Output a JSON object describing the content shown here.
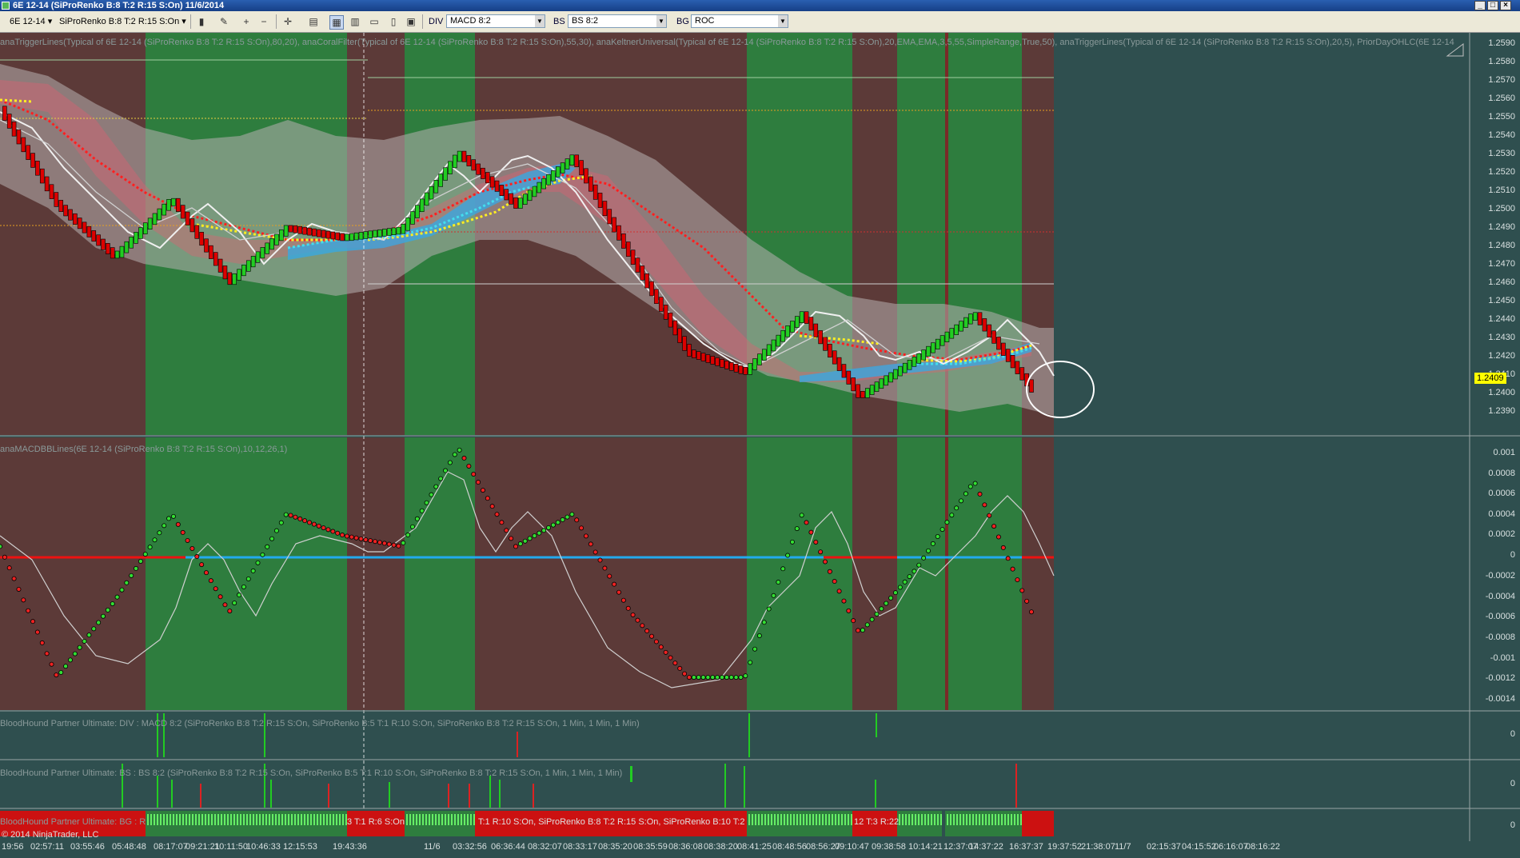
{
  "window": {
    "title": "6E 12-14 (SiProRenko B:8 T:2 R:15 S:On)  11/6/2014"
  },
  "toolbar": {
    "instrument": "6E 12-14",
    "bars": "SiProRenko B:8 T:2 R:15 S:On",
    "div_label": "DIV",
    "div_value": "MACD 8:2",
    "bs_label": "BS",
    "bs_value": "BS 8:2",
    "bg_label": "BG",
    "bg_value": "ROC"
  },
  "panels": {
    "price_indicators": "anaTriggerLines(Typical of 6E 12-14 (SiProRenko B:8 T:2 R:15 S:On),80,20), anaCoralFilter(Typical of 6E 12-14 (SiProRenko B:8 T:2 R:15 S:On),55,30), anaKeltnerUniversal(Typical of 6E 12-14 (SiProRenko B:8 T:2 R:15 S:On),20,EMA,EMA,3,5,55,SimpleRange,True,50), anaTriggerLines(Typical of 6E 12-14 (SiProRenko B:8 T:2 R:15 S:On),20,5), PriorDayOHLC(6E 12-14",
    "macd": "anaMACDBBLines(6E 12-14 (SiProRenko B:8 T:2 R:15 S:On),10,12,26,1)",
    "div": "BloodHound Partner Ultimate: DIV : MACD 8:2 (SiProRenko B:8 T:2 R:15 S:On, SiProRenko B:5 T:1 R:10 S:On, SiProRenko B:8 T:2 R:15 S:On, 1 Min, 1 Min, 1 Min)",
    "bs": "BloodHound Partner Ultimate: BS : BS 8:2 (SiProRenko B:8 T:2 R:15 S:On, SiProRenko B:5 T:1 R:10 S:On, SiProRenko B:8 T:2 R:15 S:On, 1 Min, 1 Min, 1 Min)",
    "bg": "BloodHound Partner Ultimate: BG : R",
    "bg_mid1": "3 T:1 R:6 S:On",
    "bg_mid2": "T:1 R:10 S:On, SiProRenko B:8 T:2 R:15 S:On, SiProRenko B:10 T:2",
    "bg_mid3": "12 T:3 R:22",
    "copyright": "© 2014 NinjaTrader, LLC"
  },
  "price_axis": [
    "1.2590",
    "1.2580",
    "1.2570",
    "1.2560",
    "1.2550",
    "1.2540",
    "1.2530",
    "1.2520",
    "1.2510",
    "1.2500",
    "1.2490",
    "1.2480",
    "1.2470",
    "1.2460",
    "1.2450",
    "1.2440",
    "1.2430",
    "1.2420",
    "1.2410",
    "1.2400",
    "1.2390"
  ],
  "current_price": "1.2409",
  "macd_axis": [
    "0.001",
    "0.0008",
    "0.0006",
    "0.0004",
    "0.0002",
    "0",
    "-0.0002",
    "-0.0004",
    "-0.0006",
    "-0.0008",
    "-0.001",
    "-0.0012",
    "-0.0014"
  ],
  "sub_axis": [
    "0",
    "0",
    "0"
  ],
  "time_axis": [
    "19:56",
    "02:57:11",
    "03:55:46",
    "05:48:48",
    "08:17:07",
    "09:21:21",
    "10:11:50",
    "10:46:33",
    "12:15:53",
    "19:43:36",
    "11/6",
    "03:32:56",
    "06:36:44",
    "08:32:07",
    "08:33:17",
    "08:35:20",
    "08:35:59",
    "08:36:08",
    "08:38:20",
    "08:41:25",
    "08:48:56",
    "08:56:27",
    "09:10:47",
    "09:38:58",
    "10:14:21",
    "12:37:07",
    "14:37:22",
    "16:37:37",
    "19:37:52",
    "21:38:07",
    "11/7",
    "02:15:37",
    "04:15:52",
    "06:16:07",
    "08:16:22"
  ],
  "colors": {
    "background": "#2f4f4f",
    "bull_zone": "#2e7d3e",
    "bear_zone": "#5c3a38",
    "up_bar": "#22cc22",
    "down_bar": "#dd0000",
    "macd_zero": "#ee1111",
    "macd_zero_alt": "#22aaee"
  },
  "chart_data": [
    {
      "type": "line",
      "title": "",
      "ylim": [
        1.2385,
        1.2595
      ],
      "x": [
        0,
        20,
        40,
        60,
        80,
        100,
        120,
        140,
        160,
        180,
        200,
        220,
        240,
        260,
        280,
        300,
        320,
        340,
        360
      ],
      "series": [
        {
          "values": [
            1.2555,
            1.2505,
            1.2478,
            1.2508,
            1.2465,
            1.2493,
            1.2488,
            1.2492,
            1.2532,
            1.2505,
            1.253,
            1.2478,
            1.2428,
            1.2418,
            1.2448,
            1.2405,
            1.2425,
            1.2448,
            1.2409
          ]
        }
      ]
    },
    {
      "type": "line",
      "title": "",
      "ylim": [
        -0.0015,
        0.001
      ],
      "x": [
        0,
        20,
        40,
        60,
        80,
        100,
        120,
        140,
        160,
        180,
        200,
        220,
        240,
        260,
        280,
        300,
        320,
        340,
        360
      ],
      "series": [
        {
          "values": [
            0.0,
            -0.0012,
            -0.0005,
            0.0003,
            -0.0006,
            0.0003,
            0.0001,
            0.0,
            0.0009,
            0.0,
            0.0003,
            -0.0006,
            -0.0012,
            -0.0012,
            0.0003,
            -0.0008,
            -0.0002,
            0.0006,
            -0.0006
          ]
        }
      ]
    }
  ]
}
